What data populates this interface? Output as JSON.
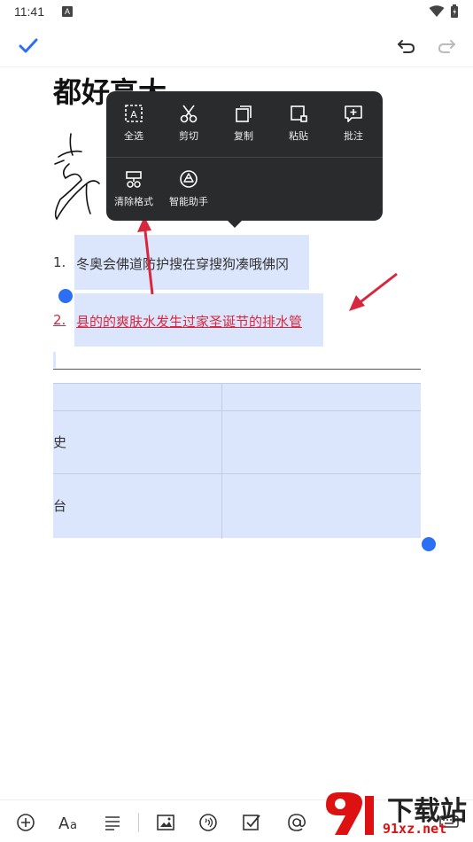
{
  "status_bar": {
    "time": "11:41",
    "app_icon_letter": "A"
  },
  "toolbar": {
    "confirm_icon": "check-icon",
    "undo_icon": "undo-icon",
    "redo_icon": "redo-icon",
    "accent_color": "#2b6ff5"
  },
  "document": {
    "title": "都好高大",
    "list": [
      {
        "number": "1.",
        "text": "冬奥会佛道防护搜在穿搜狗凑哦佛冈"
      },
      {
        "number": "2.",
        "text": "县的的爽肤水发生过家圣诞节的排水管"
      }
    ],
    "table_cells": [
      "史",
      "台"
    ],
    "selection_color": "#dbe6fd",
    "link_color": "#d8263c"
  },
  "context_menu": {
    "row1": [
      {
        "label": "全选",
        "icon": "select-all-icon"
      },
      {
        "label": "剪切",
        "icon": "scissors-icon"
      },
      {
        "label": "复制",
        "icon": "copy-icon"
      },
      {
        "label": "粘贴",
        "icon": "paste-icon"
      },
      {
        "label": "批注",
        "icon": "comment-icon"
      }
    ],
    "row2": [
      {
        "label": "清除格式",
        "icon": "clear-format-icon"
      },
      {
        "label": "智能助手",
        "icon": "smart-assistant-icon"
      }
    ]
  },
  "bottom_toolbar": {
    "icons": [
      "add-icon",
      "font-style-icon",
      "paragraph-align-icon",
      "insert-image-icon",
      "audio-icon",
      "checkbox-icon",
      "mention-icon",
      "keyboard-icon"
    ]
  },
  "watermark": {
    "brand": "下载站",
    "url": "91xz.net"
  }
}
